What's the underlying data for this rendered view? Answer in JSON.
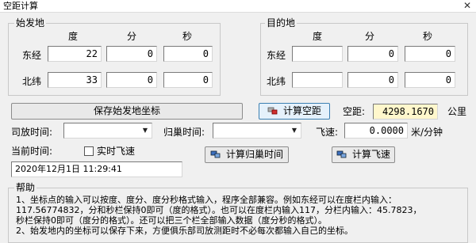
{
  "window": {
    "title": "空距计算",
    "close_glyph": "✕"
  },
  "origin": {
    "group_label": "始发地",
    "col_labels": [
      "度",
      "分",
      "秒"
    ],
    "rows": [
      {
        "label": "东经",
        "deg": "22",
        "min": "0",
        "sec": "0"
      },
      {
        "label": "北纬",
        "deg": "33",
        "min": "0",
        "sec": "0"
      }
    ],
    "save_button": "保存始发地坐标"
  },
  "destination": {
    "group_label": "目的地",
    "col_labels": [
      "度",
      "分",
      "秒"
    ],
    "rows": [
      {
        "label": "东经",
        "deg": "",
        "min": "0",
        "sec": "0"
      },
      {
        "label": "北纬",
        "deg": "",
        "min": "0",
        "sec": "0"
      }
    ]
  },
  "distance": {
    "calc_button": "计算空距",
    "label": "空距:",
    "value": "4298.1670",
    "unit": "公里"
  },
  "timing": {
    "release_label": "司放时间:",
    "release_value": "",
    "return_label": "归巢时间:",
    "return_value": "",
    "speed_label": "飞速:",
    "speed_value": "0.0000",
    "speed_unit": "米/分钟",
    "current_label": "当前时间:",
    "realtime_label": "实时飞速",
    "realtime_checked": false,
    "current_value": "2020年12月1日  11:29:41",
    "calc_return_button": "计算归巢时间",
    "calc_speed_button": "计算飞速"
  },
  "help": {
    "group_label": "帮助",
    "lines": [
      "1、坐标点的输入可以按度、度分、度分秒格式输入，程序全部兼容。例如东经可以在度栏内输入：",
      "117.56774832，分和秒栏保持0即可（度的格式）。也可以在度栏内输入117，分栏内输入：45.7823，",
      "秒栏保持0即可（度分的格式）。还可以把三个栏全部输入数据（度分秒的格式）。",
      "2、始发地内的坐标可以保存下来，方便俱乐部司放测距时不必每次都输入自己的坐标。"
    ]
  },
  "colors": {
    "result_bg": "#fff7cc",
    "window_bg": "#f0f0f0"
  }
}
